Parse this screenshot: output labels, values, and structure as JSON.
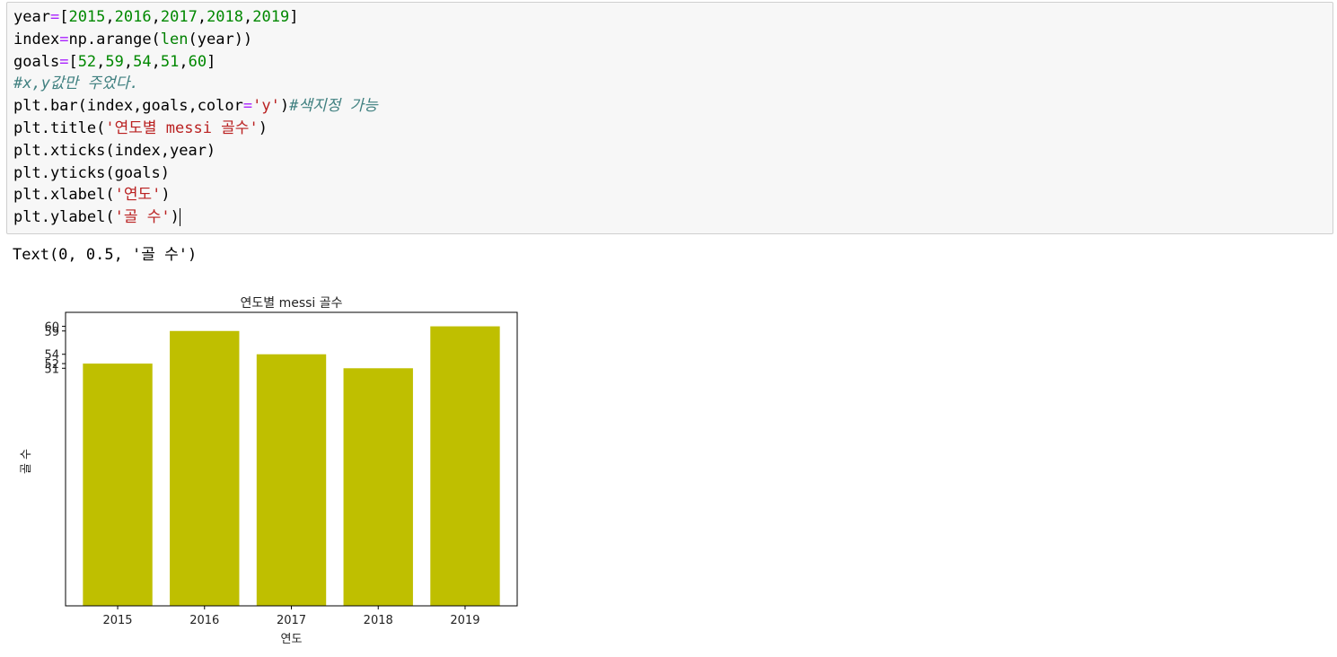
{
  "code_cell": {
    "lines": [
      [
        {
          "t": "year",
          "c": "#000000"
        },
        {
          "t": "=",
          "c": "#aa22ff"
        },
        {
          "t": "[",
          "c": "#000000"
        },
        {
          "t": "2015",
          "c": "#008800"
        },
        {
          "t": ",",
          "c": "#000000"
        },
        {
          "t": "2016",
          "c": "#008800"
        },
        {
          "t": ",",
          "c": "#000000"
        },
        {
          "t": "2017",
          "c": "#008800"
        },
        {
          "t": ",",
          "c": "#000000"
        },
        {
          "t": "2018",
          "c": "#008800"
        },
        {
          "t": ",",
          "c": "#000000"
        },
        {
          "t": "2019",
          "c": "#008800"
        },
        {
          "t": "]",
          "c": "#000000"
        }
      ],
      [
        {
          "t": "index",
          "c": "#000000"
        },
        {
          "t": "=",
          "c": "#aa22ff"
        },
        {
          "t": "np.arange(",
          "c": "#000000"
        },
        {
          "t": "len",
          "c": "#008000"
        },
        {
          "t": "(year))",
          "c": "#000000"
        }
      ],
      [
        {
          "t": "goals",
          "c": "#000000"
        },
        {
          "t": "=",
          "c": "#aa22ff"
        },
        {
          "t": "[",
          "c": "#000000"
        },
        {
          "t": "52",
          "c": "#008800"
        },
        {
          "t": ",",
          "c": "#000000"
        },
        {
          "t": "59",
          "c": "#008800"
        },
        {
          "t": ",",
          "c": "#000000"
        },
        {
          "t": "54",
          "c": "#008800"
        },
        {
          "t": ",",
          "c": "#000000"
        },
        {
          "t": "51",
          "c": "#008800"
        },
        {
          "t": ",",
          "c": "#000000"
        },
        {
          "t": "60",
          "c": "#008800"
        },
        {
          "t": "]",
          "c": "#000000"
        }
      ],
      [
        {
          "t": "#x,y값만 주었다.",
          "c": "#408080",
          "i": true
        }
      ],
      [
        {
          "t": "plt.bar(index,goals,color",
          "c": "#000000"
        },
        {
          "t": "=",
          "c": "#aa22ff"
        },
        {
          "t": "'y'",
          "c": "#ba2121"
        },
        {
          "t": ")",
          "c": "#000000"
        },
        {
          "t": "#색지정 가능",
          "c": "#408080",
          "i": true
        }
      ],
      [
        {
          "t": "plt.title(",
          "c": "#000000"
        },
        {
          "t": "'연도별 messi 골수'",
          "c": "#ba2121"
        },
        {
          "t": ")",
          "c": "#000000"
        }
      ],
      [
        {
          "t": "plt.xticks(index,year)",
          "c": "#000000"
        }
      ],
      [
        {
          "t": "plt.yticks(goals)",
          "c": "#000000"
        }
      ],
      [
        {
          "t": "plt.xlabel(",
          "c": "#000000"
        },
        {
          "t": "'연도'",
          "c": "#ba2121"
        },
        {
          "t": ")",
          "c": "#000000"
        }
      ],
      [
        {
          "t": "plt.ylabel(",
          "c": "#000000"
        },
        {
          "t": "'골 수'",
          "c": "#ba2121"
        },
        {
          "t": ")",
          "c": "#000000"
        }
      ]
    ],
    "cursor_line": 9
  },
  "output": {
    "text": "Text(0, 0.5, '골 수')"
  },
  "chart_data": {
    "type": "bar",
    "title": "연도별 messi 골수",
    "xlabel": "연도",
    "ylabel": "골 수",
    "categories": [
      "2015",
      "2016",
      "2017",
      "2018",
      "2019"
    ],
    "values": [
      52,
      59,
      54,
      51,
      60
    ],
    "yticks": [
      52,
      59,
      54,
      51,
      60
    ],
    "ylim": [
      0,
      63
    ],
    "bar_color": "#bfbf00",
    "grid": false
  }
}
